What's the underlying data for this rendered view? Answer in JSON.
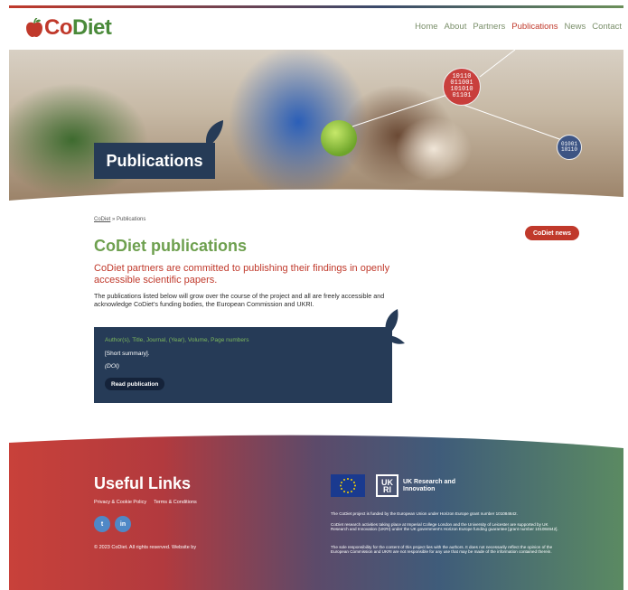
{
  "brand": {
    "logo_co": "Co",
    "logo_diet": "Diet"
  },
  "nav": {
    "items": [
      {
        "label": "Home"
      },
      {
        "label": "About"
      },
      {
        "label": "Partners"
      },
      {
        "label": "Publications"
      },
      {
        "label": "News"
      },
      {
        "label": "Contact"
      }
    ],
    "active": "Publications"
  },
  "hero": {
    "title": "Publications",
    "binary_1": "10110\n011001\n101010\n01101",
    "binary_2": "01001\n10110"
  },
  "breadcrumb": {
    "home": "CoDiet",
    "separator": "»",
    "current": "Publications"
  },
  "news_button": "CoDiet news",
  "main": {
    "title": "CoDiet publications",
    "lead": "CoDiet partners are committed to publishing their findings in openly accessible scientific papers.",
    "intro": "The publications listed below will grow over the course of the project and all are freely accessible and acknowledge CoDiet’s funding bodies, the European Commission and UKRI."
  },
  "publication": {
    "meta": "Author(s), Title, Journal, (Year), Volume, Page numbers",
    "summary": "[Short summary].",
    "doi": "(DOI)",
    "button": "Read publication"
  },
  "footer": {
    "useful_title": "Useful Links",
    "links": [
      {
        "label": "Privacy & Cookie Policy"
      },
      {
        "label": "Terms & Conditions"
      }
    ],
    "social": [
      {
        "label": "t",
        "icon": "twitter-icon"
      },
      {
        "label": "in",
        "icon": "linkedin-icon"
      }
    ],
    "copyright": "© 2023 CoDiet. All rights reserved. Website by",
    "ukri_mark": "UK RI",
    "ukri_name": "UK Research and Innovation",
    "funding_1": "The CoDiet project is funded by the European Union under Horizon Europe grant number 101084642.",
    "funding_2": "CoDiet research activities taking place at Imperial College London and the University of Leicester are supported by UK Research and Innovation (UKRI) under the UK government’s Horizon Europe funding guarantee [grant number 101084642].",
    "funding_3": "The sole responsibility for the content of this project lies with the authors. It does not necessarily reflect the opinion of the European Commission and UKRI are not responsible for any use that may be made of the information contained therein."
  },
  "colors": {
    "brand_red": "#c0392b",
    "brand_green": "#6ea04f",
    "navy": "#263b57"
  }
}
